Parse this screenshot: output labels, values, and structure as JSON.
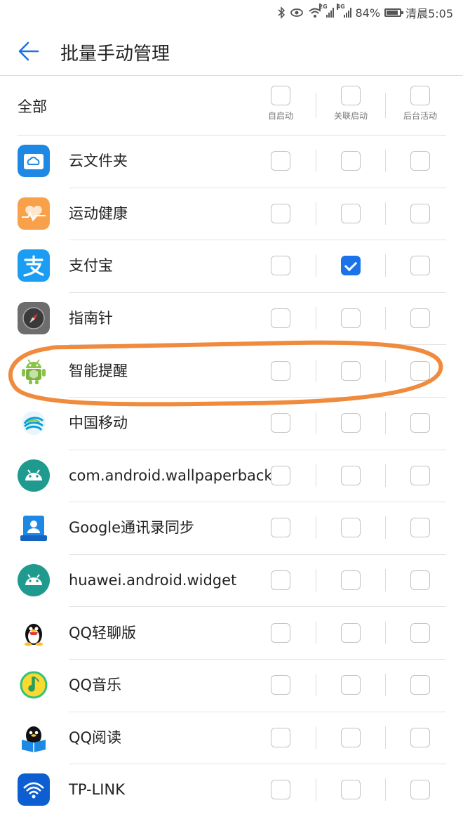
{
  "status": {
    "battery": "84%",
    "carrier_time": "清晨5:05",
    "sig1": "2G",
    "sig2": "4G"
  },
  "header": {
    "title": "批量手动管理"
  },
  "columns": {
    "all": "全部",
    "auto_start": "自启动",
    "linked_start": "关联启动",
    "bg_activity": "后台活动"
  },
  "apps": [
    {
      "name": "云文件夹",
      "icon": "cloud-folder-icon",
      "checks": [
        false,
        false,
        false
      ]
    },
    {
      "name": "运动健康",
      "icon": "health-icon",
      "checks": [
        false,
        false,
        false
      ]
    },
    {
      "name": "支付宝",
      "icon": "alipay-icon",
      "checks": [
        false,
        true,
        false
      ]
    },
    {
      "name": "指南针",
      "icon": "compass-icon",
      "checks": [
        false,
        false,
        false
      ]
    },
    {
      "name": "智能提醒",
      "icon": "smart-reminder-icon",
      "checks": [
        false,
        false,
        false
      ]
    },
    {
      "name": "中国移动",
      "icon": "china-mobile-icon",
      "checks": [
        false,
        false,
        false
      ]
    },
    {
      "name": "com.android.wallpaperbackup",
      "icon": "android-icon",
      "checks": [
        false,
        false,
        false
      ]
    },
    {
      "name": "Google通讯录同步",
      "icon": "contacts-sync-icon",
      "checks": [
        false,
        false,
        false
      ]
    },
    {
      "name": "huawei.android.widget",
      "icon": "android-icon",
      "checks": [
        false,
        false,
        false
      ]
    },
    {
      "name": "QQ轻聊版",
      "icon": "qq-penguin-icon",
      "checks": [
        false,
        false,
        false
      ]
    },
    {
      "name": "QQ音乐",
      "icon": "qq-music-icon",
      "checks": [
        false,
        false,
        false
      ]
    },
    {
      "name": "QQ阅读",
      "icon": "qq-reader-icon",
      "checks": [
        false,
        false,
        false
      ]
    },
    {
      "name": "TP-LINK",
      "icon": "tplink-icon",
      "checks": [
        false,
        false,
        false
      ]
    }
  ],
  "colors": {
    "accent": "#1a73e8",
    "annotation": "#f08a3c"
  }
}
